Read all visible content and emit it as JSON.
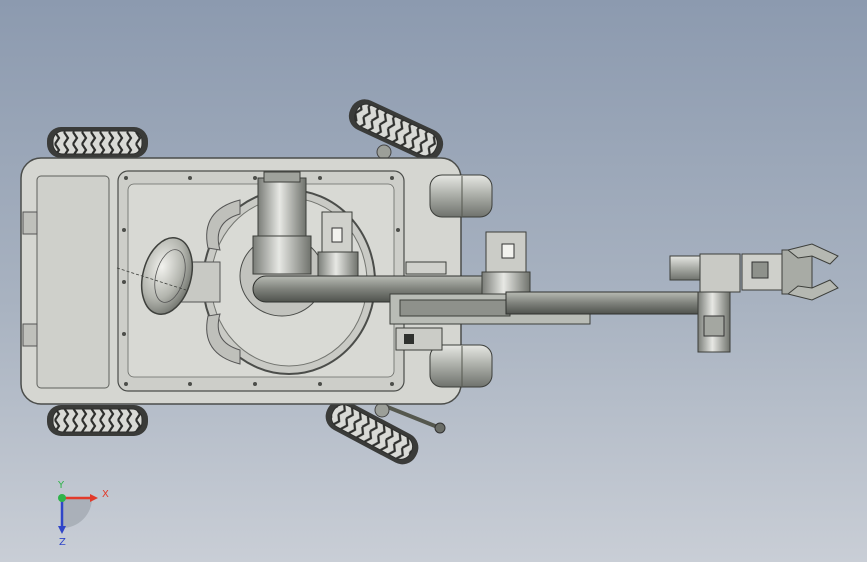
{
  "triad": {
    "x_label": "X",
    "y_label": "Y",
    "z_label": "Z",
    "x_color": "#e23a2a",
    "y_color": "#2fb34a",
    "z_color": "#2f45c8"
  },
  "model": {
    "body_color": "#d5d6d1",
    "metal_color": "#b9bcb6",
    "dark_metal": "#5a5d58",
    "tire_color": "#3a3b39"
  },
  "icons": [
    "coordinate-triad-icon"
  ]
}
